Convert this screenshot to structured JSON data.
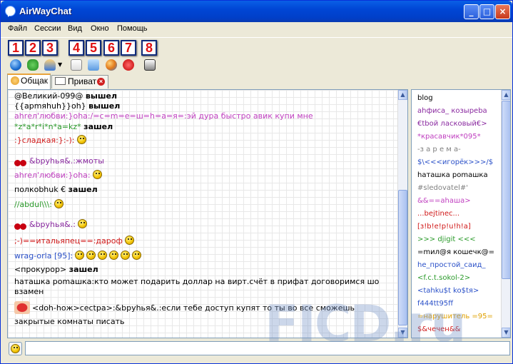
{
  "window": {
    "title": "AirWayChat"
  },
  "menu": [
    "Файл",
    "Сессии",
    "Вид",
    "Окно",
    "Помощь"
  ],
  "toolbar_numbers": [
    "1",
    "2",
    "3",
    "4",
    "5",
    "6",
    "7",
    "8"
  ],
  "tabs": {
    "general": "Общак",
    "private": "Приват"
  },
  "messages": [
    {
      "parts": [
        {
          "t": "@Великий-099@ ",
          "c": "#000"
        },
        {
          "t": "вышел",
          "c": "#000",
          "b": true
        }
      ]
    },
    {
      "parts": [
        {
          "t": "{{apmяhuh}}oh} ",
          "c": "#000"
        },
        {
          "t": "вышел",
          "c": "#000",
          "b": true
        }
      ]
    },
    {
      "parts": [
        {
          "t": "ahrел'любви:}oha:/=c=m=e=ш=h=a=я=:эй дура быстро авик купи мне",
          "c": "#c040c0"
        }
      ]
    },
    {
      "parts": [
        {
          "t": "*z*a*r*i*n*a=kz* ",
          "c": "#2a9a2a"
        },
        {
          "t": "зашел",
          "c": "#000",
          "b": true
        }
      ]
    },
    {
      "parts": [
        {
          "t": ":}сладкая:}:-):",
          "c": "#d01818"
        }
      ],
      "smileys": 1
    },
    {
      "parts": [
        {
          "t": "&bpyhья&.:жмоты",
          "c": "#8a2aa0"
        }
      ],
      "cherry": true
    },
    {
      "parts": [
        {
          "t": "ahrел'любви:}oha:",
          "c": "#c040c0"
        }
      ],
      "smileys": 1
    },
    {
      "parts": [
        {
          "t": "полкоbhuk € ",
          "c": "#000"
        },
        {
          "t": "зашел",
          "c": "#000",
          "b": true
        }
      ]
    },
    {
      "parts": [
        {
          "t": "//abdul\\\\\\:",
          "c": "#2a9a2a"
        }
      ],
      "smileys": 1
    },
    {
      "parts": [
        {
          "t": "&bpyhья&.:",
          "c": "#8a2aa0"
        }
      ],
      "cherry": true,
      "smileys": 1
    },
    {
      "parts": [
        {
          "t": ";-)==итальяпец==:дароф",
          "c": "#d01818"
        }
      ],
      "smileys": 1
    },
    {
      "parts": [
        {
          "t": "wrag-orla [95]:",
          "c": "#2a50c8"
        }
      ],
      "smileys": 6
    },
    {
      "parts": [
        {
          "t": "<прокурор> ",
          "c": "#000"
        },
        {
          "t": "зашел",
          "c": "#000",
          "b": true
        }
      ]
    },
    {
      "parts": [
        {
          "t": "haташка pomaшка:кто может подарить доллар на вирт.счёт в прифат договоримся шо",
          "c": "#000"
        }
      ]
    },
    {
      "parts": [
        {
          "t": "взамен",
          "c": "#000"
        }
      ]
    },
    {
      "parts": [
        {
          "t": "<doh-hoж>cectpa>:&bpyhья&.:если тебе доступ купят то ты во все сможешь",
          "c": "#000"
        }
      ],
      "lips": true
    },
    {
      "parts": [
        {
          "t": "закрытые комнаты писать",
          "c": "#000"
        }
      ]
    }
  ],
  "users": [
    {
      "name": "blog",
      "color": "#000"
    },
    {
      "name": "ahфиса_ козыpeba",
      "color": "#8a2aa0"
    },
    {
      "name": "€tbой ласковый€>",
      "color": "#8a2aa0"
    },
    {
      "name": "*красавчик*095*",
      "color": "#c040c0"
    },
    {
      "name": "-з а р е м а-",
      "color": "#808080"
    },
    {
      "name": "$\\<<<игорёк>>>/$",
      "color": "#2a50c8"
    },
    {
      "name": "haташка pomaшка",
      "color": "#000"
    },
    {
      "name": "#sledovatel#'",
      "color": "#808080"
    },
    {
      "name": "&&==ahaшa>",
      "color": "#c040c0"
    },
    {
      "name": "...bejtinec...",
      "color": "#d01818"
    },
    {
      "name": "[з!b!e!p!u!h!a]",
      "color": "#d01818"
    },
    {
      "name": ">>> djigit <<<",
      "color": "#2a9a2a"
    },
    {
      "name": "=mил@я кошечк@=",
      "color": "#000"
    },
    {
      "name": "he_простой_caид_",
      "color": "#2a50c8"
    },
    {
      "name": "<f.c.t.sokol-2>",
      "color": "#2a9a2a"
    },
    {
      "name": "<tahku$t ko$tя>",
      "color": "#2a50c8"
    },
    {
      "name": "f444tt95ff",
      "color": "#2a50c8"
    },
    {
      "name": "=нарушитель =95=",
      "color": "#e0a000"
    },
    {
      "name": "$&чечен&&",
      "color": "#d01818"
    }
  ],
  "watermark": "FICD.ru"
}
